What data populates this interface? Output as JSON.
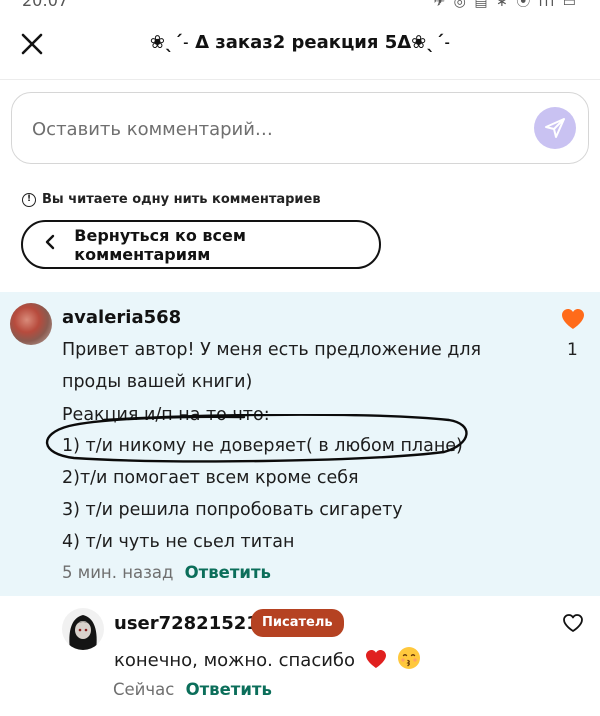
{
  "status_bar": {
    "time": "20:07",
    "icons": "✈ ◎ ▤  ∗ ⦿ ıll ▭"
  },
  "header": {
    "title": "❀ˎˊ˗ Δ заказ2 реакция 5Δ❀ˎˊ˗"
  },
  "comment_input": {
    "placeholder": "Оставить комментарий…"
  },
  "thread_note": {
    "text": "Вы читаете одну нить комментариев"
  },
  "back_button": {
    "label": "Вернуться ко всем комментариям"
  },
  "main_comment": {
    "username": "avaleria568",
    "likes": "1",
    "lines": [
      "Привет автор! У меня есть предложение для",
      "проды вашей книги)",
      "Реакция и/п на то что:",
      "1) т/и никому не доверяет( в любом плане)",
      "2)т/и помогает всем кроме себя",
      "3) т/и решила попробовать сигарету",
      "4) т/и чуть не сьел титан"
    ],
    "timestamp": "5 мин. назад",
    "reply_label": "Ответить"
  },
  "reply_comment": {
    "username": "user72821521",
    "badge": "Писатель",
    "text": "конечно, можно. спасибо",
    "timestamp": "Сейчас",
    "reply_label": "Ответить"
  },
  "colors": {
    "highlight_bg": "#eaf6fa",
    "like_heart": "#ff6b1a",
    "reply_link": "#0b6e5a",
    "writer_badge": "#b54222",
    "send_button": "#c9c2f2"
  }
}
